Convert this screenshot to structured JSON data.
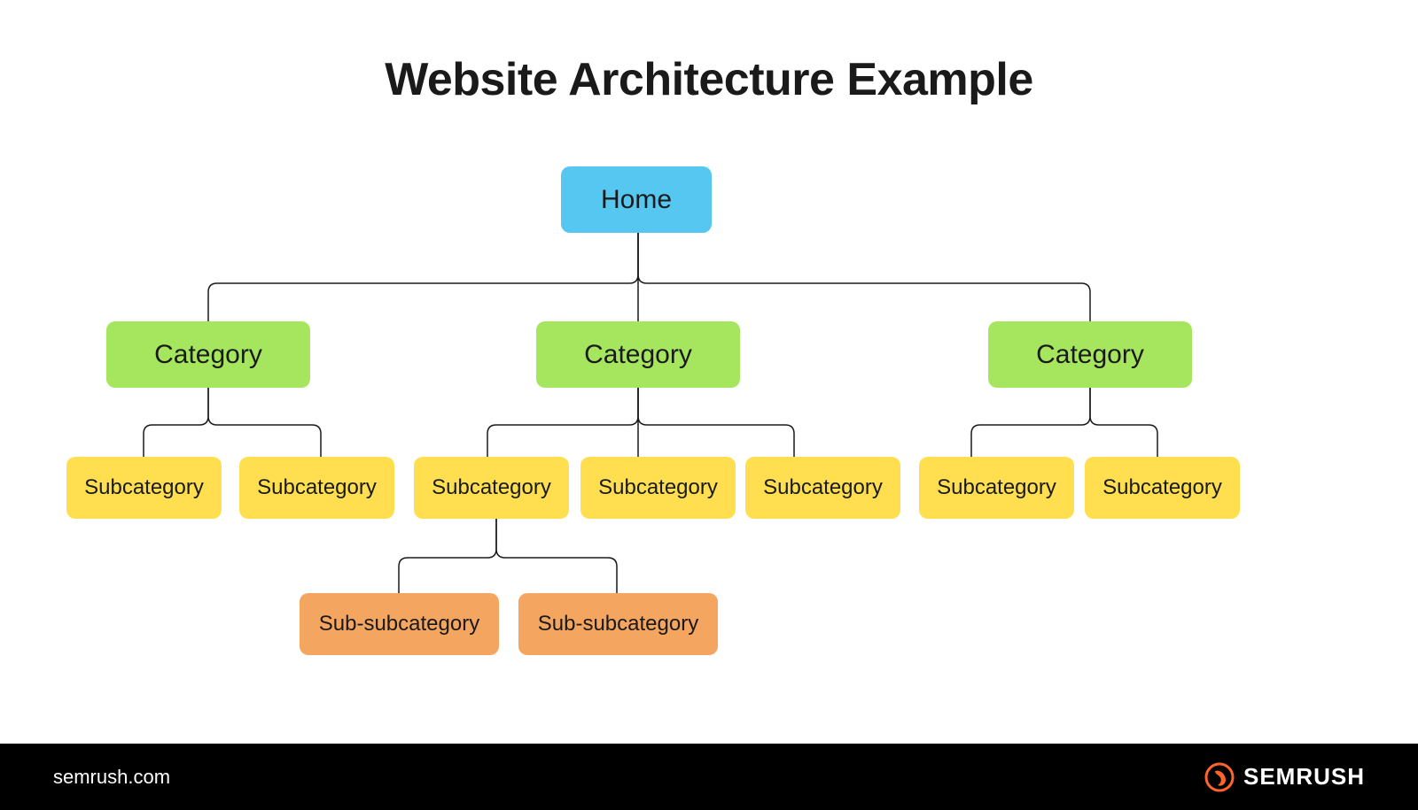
{
  "title": "Website Architecture Example",
  "footer": {
    "domain": "semrush.com",
    "brand": "SEMRUSH"
  },
  "colors": {
    "home": "#55c7f0",
    "category": "#a6e65f",
    "subcategory": "#ffdf50",
    "subSubcategory": "#f4a55f",
    "accent": "#ff642d",
    "line": "#1a1a1a",
    "footerBg": "#000000"
  },
  "diagram": {
    "root": {
      "label": "Home"
    },
    "categories": [
      {
        "label": "Category",
        "children": [
          {
            "label": "Subcategory"
          },
          {
            "label": "Subcategory"
          }
        ]
      },
      {
        "label": "Category",
        "children": [
          {
            "label": "Subcategory",
            "children": [
              {
                "label": "Sub-subcategory"
              },
              {
                "label": "Sub-subcategory"
              }
            ]
          },
          {
            "label": "Subcategory"
          },
          {
            "label": "Subcategory"
          }
        ]
      },
      {
        "label": "Category",
        "children": [
          {
            "label": "Subcategory"
          },
          {
            "label": "Subcategory"
          }
        ]
      }
    ]
  }
}
